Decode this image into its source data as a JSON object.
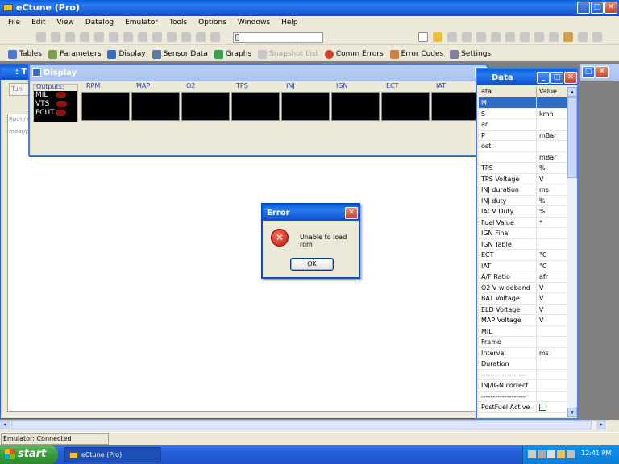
{
  "app": {
    "title": "eCtune (Pro)"
  },
  "menu": [
    "File",
    "Edit",
    "View",
    "Datalog",
    "Emulator",
    "Tools",
    "Options",
    "Windows",
    "Help"
  ],
  "toolbar2": {
    "items": [
      {
        "label": "Tables",
        "color": "#4a7bc8",
        "enabled": true
      },
      {
        "label": "Parameters",
        "color": "#7aa04a",
        "enabled": true
      },
      {
        "label": "Display",
        "color": "#3a6ac8",
        "enabled": true
      },
      {
        "label": "Sensor Data",
        "color": "#5a7aa8",
        "enabled": true
      },
      {
        "label": "Graphs",
        "color": "#3aa04a",
        "enabled": true
      },
      {
        "label": "Snapshot List",
        "color": "#b0b0b0",
        "enabled": false
      },
      {
        "label": "Comm Errors",
        "color": "#d04020",
        "enabled": true
      },
      {
        "label": "Error Codes",
        "color": "#d08040",
        "enabled": true
      },
      {
        "label": "Settings",
        "color": "#8080a0",
        "enabled": true
      }
    ]
  },
  "background_window": {
    "title": ": T",
    "tab": "Tun",
    "row1": "Rpm / C",
    "row2": "mbar/p"
  },
  "display": {
    "title": "Display",
    "outputs_label": "Outputs:",
    "outputs": [
      "MIL",
      "VTS",
      "FCUT"
    ],
    "columns": [
      "RPM",
      "MAP",
      "O2",
      "TPS",
      "INJ",
      "IGN",
      "ECT",
      "IAT"
    ]
  },
  "sensor_data": {
    "title": "Data",
    "col_name": "ata",
    "col_value": "Value",
    "rows": [
      {
        "name": "M",
        "unit": ""
      },
      {
        "name": "S",
        "unit": "kmh"
      },
      {
        "name": "ar",
        "unit": ""
      },
      {
        "name": "P",
        "unit": "mBar"
      },
      {
        "name": "ost",
        "unit": ""
      },
      {
        "name": "",
        "unit": "mBar"
      },
      {
        "name": "TPS",
        "unit": "%"
      },
      {
        "name": "TPS Voltage",
        "unit": "V"
      },
      {
        "name": "INJ duration",
        "unit": "ms"
      },
      {
        "name": "INJ duty",
        "unit": "%"
      },
      {
        "name": "IACV Duty",
        "unit": "%"
      },
      {
        "name": "Fuel Value",
        "unit": "*"
      },
      {
        "name": "IGN Final",
        "unit": ""
      },
      {
        "name": "IGN Table",
        "unit": ""
      },
      {
        "name": "ECT",
        "unit": "°C"
      },
      {
        "name": "IAT",
        "unit": "°C"
      },
      {
        "name": "A/F Ratio",
        "unit": "afr"
      },
      {
        "name": "O2 V wideband",
        "unit": "V"
      },
      {
        "name": "BAT Voltage",
        "unit": "V"
      },
      {
        "name": "ELD Voltage",
        "unit": "V"
      },
      {
        "name": "MAP Voltage",
        "unit": "V"
      },
      {
        "name": "MIL",
        "unit": ""
      },
      {
        "name": "Frame",
        "unit": ""
      },
      {
        "name": "Interval",
        "unit": "ms"
      },
      {
        "name": "Duration",
        "unit": ""
      },
      {
        "name": "-------------------",
        "unit": ""
      },
      {
        "name": "INJ/IGN correct",
        "unit": ""
      },
      {
        "name": "-------------------",
        "unit": ""
      },
      {
        "name": "PostFuel Active",
        "unit": ""
      }
    ]
  },
  "error_dialog": {
    "title": "Error",
    "message": "Unable to load rom",
    "ok": "OK"
  },
  "status": {
    "text": "Emulator: Connected"
  },
  "taskbar": {
    "start": "start",
    "task": "eCtune (Pro)",
    "clock": "12:41 PM"
  }
}
